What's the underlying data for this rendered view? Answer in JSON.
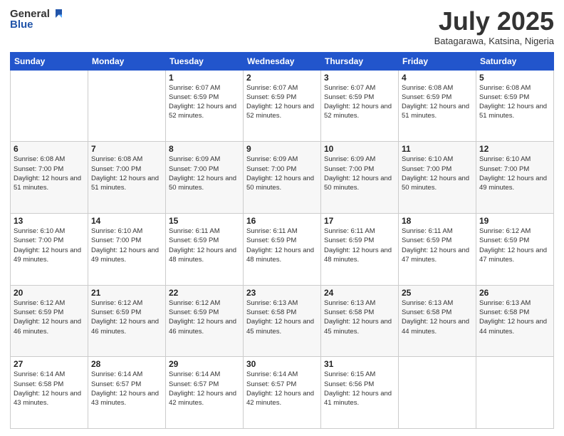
{
  "header": {
    "logo_general": "General",
    "logo_blue": "Blue",
    "title": "July 2025",
    "location": "Batagarawa, Katsina, Nigeria"
  },
  "days_of_week": [
    "Sunday",
    "Monday",
    "Tuesday",
    "Wednesday",
    "Thursday",
    "Friday",
    "Saturday"
  ],
  "weeks": [
    [
      {
        "day": "",
        "info": ""
      },
      {
        "day": "",
        "info": ""
      },
      {
        "day": "1",
        "info": "Sunrise: 6:07 AM\nSunset: 6:59 PM\nDaylight: 12 hours and 52 minutes."
      },
      {
        "day": "2",
        "info": "Sunrise: 6:07 AM\nSunset: 6:59 PM\nDaylight: 12 hours and 52 minutes."
      },
      {
        "day": "3",
        "info": "Sunrise: 6:07 AM\nSunset: 6:59 PM\nDaylight: 12 hours and 52 minutes."
      },
      {
        "day": "4",
        "info": "Sunrise: 6:08 AM\nSunset: 6:59 PM\nDaylight: 12 hours and 51 minutes."
      },
      {
        "day": "5",
        "info": "Sunrise: 6:08 AM\nSunset: 6:59 PM\nDaylight: 12 hours and 51 minutes."
      }
    ],
    [
      {
        "day": "6",
        "info": "Sunrise: 6:08 AM\nSunset: 7:00 PM\nDaylight: 12 hours and 51 minutes."
      },
      {
        "day": "7",
        "info": "Sunrise: 6:08 AM\nSunset: 7:00 PM\nDaylight: 12 hours and 51 minutes."
      },
      {
        "day": "8",
        "info": "Sunrise: 6:09 AM\nSunset: 7:00 PM\nDaylight: 12 hours and 50 minutes."
      },
      {
        "day": "9",
        "info": "Sunrise: 6:09 AM\nSunset: 7:00 PM\nDaylight: 12 hours and 50 minutes."
      },
      {
        "day": "10",
        "info": "Sunrise: 6:09 AM\nSunset: 7:00 PM\nDaylight: 12 hours and 50 minutes."
      },
      {
        "day": "11",
        "info": "Sunrise: 6:10 AM\nSunset: 7:00 PM\nDaylight: 12 hours and 50 minutes."
      },
      {
        "day": "12",
        "info": "Sunrise: 6:10 AM\nSunset: 7:00 PM\nDaylight: 12 hours and 49 minutes."
      }
    ],
    [
      {
        "day": "13",
        "info": "Sunrise: 6:10 AM\nSunset: 7:00 PM\nDaylight: 12 hours and 49 minutes."
      },
      {
        "day": "14",
        "info": "Sunrise: 6:10 AM\nSunset: 7:00 PM\nDaylight: 12 hours and 49 minutes."
      },
      {
        "day": "15",
        "info": "Sunrise: 6:11 AM\nSunset: 6:59 PM\nDaylight: 12 hours and 48 minutes."
      },
      {
        "day": "16",
        "info": "Sunrise: 6:11 AM\nSunset: 6:59 PM\nDaylight: 12 hours and 48 minutes."
      },
      {
        "day": "17",
        "info": "Sunrise: 6:11 AM\nSunset: 6:59 PM\nDaylight: 12 hours and 48 minutes."
      },
      {
        "day": "18",
        "info": "Sunrise: 6:11 AM\nSunset: 6:59 PM\nDaylight: 12 hours and 47 minutes."
      },
      {
        "day": "19",
        "info": "Sunrise: 6:12 AM\nSunset: 6:59 PM\nDaylight: 12 hours and 47 minutes."
      }
    ],
    [
      {
        "day": "20",
        "info": "Sunrise: 6:12 AM\nSunset: 6:59 PM\nDaylight: 12 hours and 46 minutes."
      },
      {
        "day": "21",
        "info": "Sunrise: 6:12 AM\nSunset: 6:59 PM\nDaylight: 12 hours and 46 minutes."
      },
      {
        "day": "22",
        "info": "Sunrise: 6:12 AM\nSunset: 6:59 PM\nDaylight: 12 hours and 46 minutes."
      },
      {
        "day": "23",
        "info": "Sunrise: 6:13 AM\nSunset: 6:58 PM\nDaylight: 12 hours and 45 minutes."
      },
      {
        "day": "24",
        "info": "Sunrise: 6:13 AM\nSunset: 6:58 PM\nDaylight: 12 hours and 45 minutes."
      },
      {
        "day": "25",
        "info": "Sunrise: 6:13 AM\nSunset: 6:58 PM\nDaylight: 12 hours and 44 minutes."
      },
      {
        "day": "26",
        "info": "Sunrise: 6:13 AM\nSunset: 6:58 PM\nDaylight: 12 hours and 44 minutes."
      }
    ],
    [
      {
        "day": "27",
        "info": "Sunrise: 6:14 AM\nSunset: 6:58 PM\nDaylight: 12 hours and 43 minutes."
      },
      {
        "day": "28",
        "info": "Sunrise: 6:14 AM\nSunset: 6:57 PM\nDaylight: 12 hours and 43 minutes."
      },
      {
        "day": "29",
        "info": "Sunrise: 6:14 AM\nSunset: 6:57 PM\nDaylight: 12 hours and 42 minutes."
      },
      {
        "day": "30",
        "info": "Sunrise: 6:14 AM\nSunset: 6:57 PM\nDaylight: 12 hours and 42 minutes."
      },
      {
        "day": "31",
        "info": "Sunrise: 6:15 AM\nSunset: 6:56 PM\nDaylight: 12 hours and 41 minutes."
      },
      {
        "day": "",
        "info": ""
      },
      {
        "day": "",
        "info": ""
      }
    ]
  ]
}
